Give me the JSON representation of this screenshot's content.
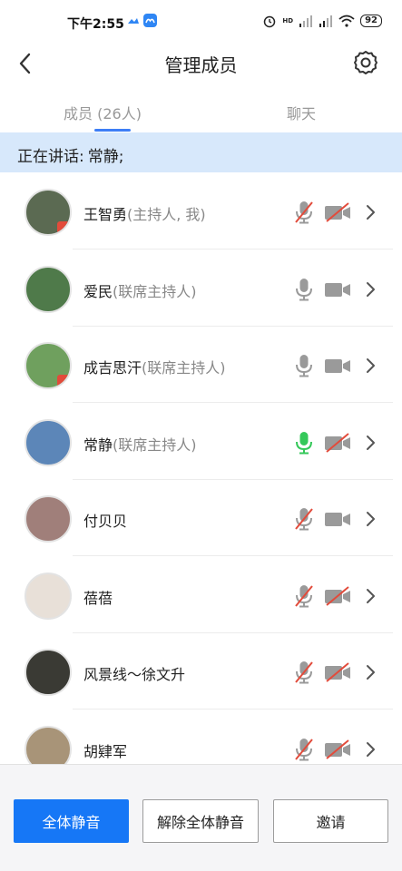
{
  "status_bar": {
    "time": "下午2:55",
    "battery": "92",
    "hd_label": "HD"
  },
  "header": {
    "title": "管理成员"
  },
  "tabs": [
    {
      "label": "成员 (26人)",
      "active": true
    },
    {
      "label": "聊天",
      "active": false
    }
  ],
  "speaking": {
    "prefix": "正在讲话:",
    "names": "常静;"
  },
  "members": [
    {
      "name": "王智勇",
      "role": "(主持人, 我)",
      "mic": "muted",
      "camera": "off",
      "avatar_color": "#5b6a52",
      "badge": true
    },
    {
      "name": "爱民",
      "role": "(联席主持人)",
      "mic": "on",
      "camera": "on",
      "avatar_color": "#4f7a4a",
      "badge": false
    },
    {
      "name": "成吉思汗",
      "role": "(联席主持人)",
      "mic": "on",
      "camera": "on",
      "avatar_color": "#6fa05e",
      "badge": true
    },
    {
      "name": "常静",
      "role": "(联席主持人)",
      "mic": "speaking",
      "camera": "off",
      "avatar_color": "#5c86b8",
      "badge": false
    },
    {
      "name": "付贝贝",
      "role": "",
      "mic": "muted",
      "camera": "on",
      "avatar_color": "#a07f7a",
      "badge": false
    },
    {
      "name": "蓓蓓",
      "role": "",
      "mic": "muted",
      "camera": "off",
      "avatar_color": "#e8e0d8",
      "badge": false
    },
    {
      "name": "风景线～徐文升",
      "role": "",
      "mic": "muted",
      "camera": "off",
      "avatar_color": "#3a3a34",
      "badge": false
    },
    {
      "name": "胡肄军",
      "role": "",
      "mic": "muted",
      "camera": "off",
      "avatar_color": "#a89478",
      "badge": false
    }
  ],
  "footer": {
    "mute_all": "全体静音",
    "unmute_all": "解除全体静音",
    "invite": "邀请"
  },
  "colors": {
    "accent": "#1677f6",
    "speaking_bg": "#d7e8fb",
    "mic_active": "#35c85a",
    "muted_slash": "#e24b3b",
    "icon_gray": "#9a9a9a"
  }
}
